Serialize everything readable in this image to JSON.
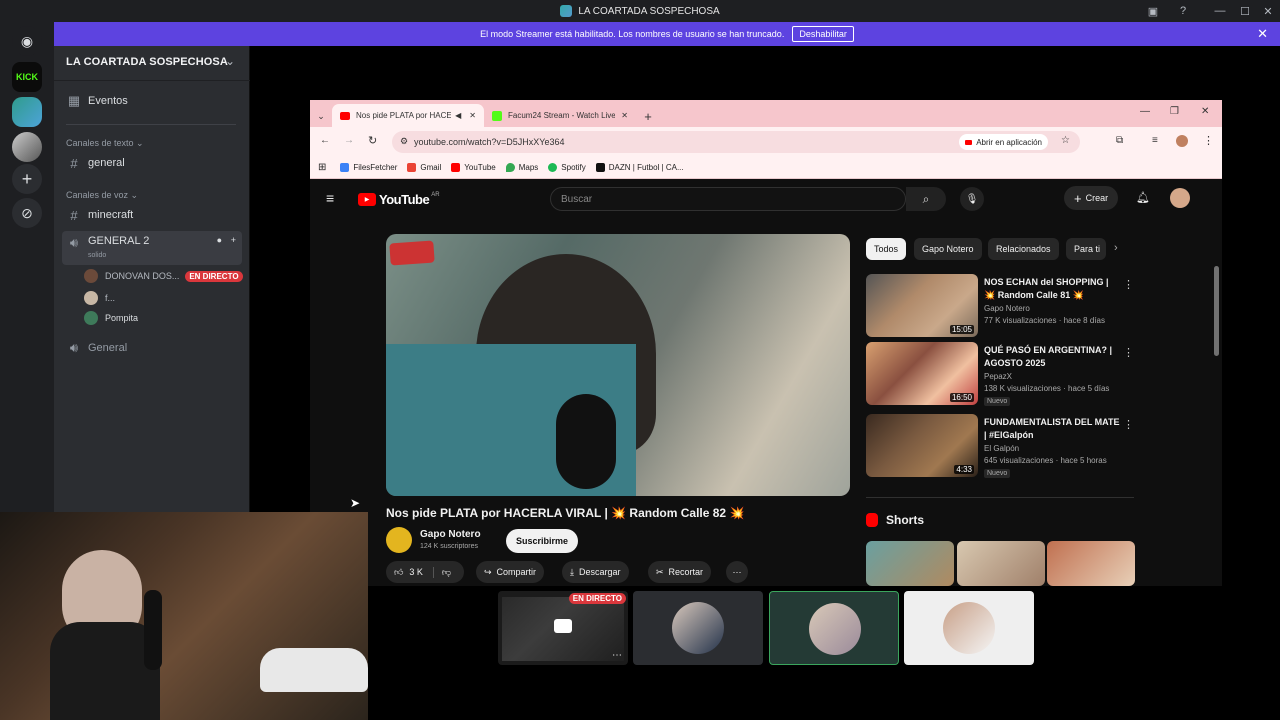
{
  "window": {
    "title": "LA COARTADA SOSPECHOSA"
  },
  "banner": {
    "text": "El modo Streamer está habilitado. Los nombres de usuario se han truncado.",
    "button": "Deshabilitar"
  },
  "servers": {
    "kick_label": "KICK"
  },
  "sidebar": {
    "guild_name": "LA COARTADA SOSPECHOSA",
    "events": "Eventos",
    "text_category": "Canales de texto",
    "text_channels": [
      "general"
    ],
    "voice_category": "Canales de voz",
    "voice_channels": [
      "minecraft",
      "GENERAL 2",
      "General"
    ],
    "general2_status": "solido",
    "voice_users": [
      {
        "name": "DONOVAN DOS...",
        "live": "EN DIRECTO"
      },
      {
        "name": "f..."
      },
      {
        "name": "Pompita"
      }
    ]
  },
  "browser": {
    "tabs": [
      {
        "label": "Nos pide PLATA por HACER"
      },
      {
        "label": "Facum24 Stream - Watch Live o"
      }
    ],
    "url": "youtube.com/watch?v=D5JHxXYe364",
    "open_app": "Abrir en aplicación",
    "bookmarks": [
      "FilesFetcher",
      "Gmail",
      "YouTube",
      "Maps",
      "Spotify",
      "DAZN | Futbol | CA..."
    ]
  },
  "youtube": {
    "logo": "YouTube",
    "region": "AR",
    "search_placeholder": "Buscar",
    "create": "Crear",
    "video_title": "Nos pide PLATA por HACERLA VIRAL | 💥 Random Calle 82 💥",
    "channel": "Gapo Notero",
    "subscribers": "124 K suscriptores",
    "subscribe": "Suscribirme",
    "likes": "3 K",
    "share": "Compartir",
    "download": "Descargar",
    "clip": "Recortar",
    "chips": [
      "Todos",
      "Gapo Notero",
      "Relacionados",
      "Para ti"
    ],
    "recommendations": [
      {
        "title": "NOS ECHAN del SHOPPING | 💥 Random Calle 81 💥",
        "channel": "Gapo Notero",
        "meta": "77 K visualizaciones · hace 8 días",
        "duration": "15:05",
        "badge": ""
      },
      {
        "title": "QUÉ PASÓ EN ARGENTINA? | AGOSTO 2025",
        "channel": "PepazX",
        "meta": "138 K visualizaciones · hace 5 días",
        "duration": "16:50",
        "badge": "Nuevo"
      },
      {
        "title": "FUNDAMENTALISTA DEL MATE | #ElGalpón",
        "channel": "El Galpón",
        "meta": "645 visualizaciones · hace 5 horas",
        "duration": "4:33",
        "badge": "Nuevo"
      }
    ],
    "shorts_label": "Shorts"
  },
  "call": {
    "live_label": "EN DIRECTO"
  },
  "colors": {
    "discord_bg": "#2b2d31",
    "banner": "#5d43e0",
    "youtube_red": "#ff0000",
    "live_red": "#da373c",
    "browser_tab": "#f6c6cc"
  }
}
